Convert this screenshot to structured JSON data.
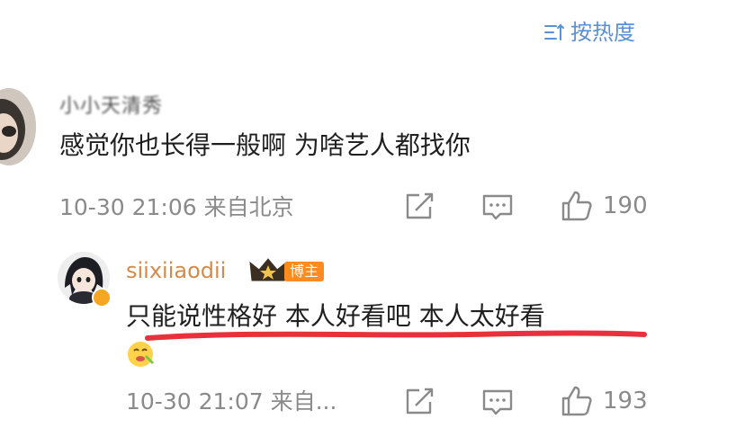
{
  "sort": {
    "label": "按热度"
  },
  "comments": [
    {
      "username": "小小天清秀",
      "text": "感觉你也长得一般啊 为啥艺人都找你",
      "meta": "10-30 21:06 来自北京",
      "likes": "190"
    },
    {
      "username": "siixiiaodii",
      "badge": "博主",
      "text": "只能说性格好 本人好看吧 本人太好看",
      "meta": "10-30 21:07 来自...",
      "likes": "193"
    }
  ],
  "colors": {
    "accent_blue": "#5b8fd6",
    "username_orange": "#d48a4a",
    "badge_orange": "#ff8a1e",
    "underline_red": "#e8313d",
    "meta_gray": "#8a8a8a"
  }
}
